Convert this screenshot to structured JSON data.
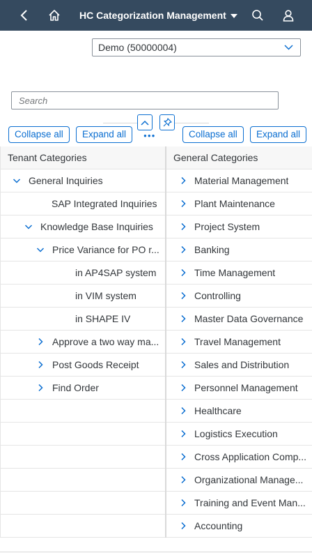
{
  "header": {
    "title": "HC Categorization Management",
    "back_icon": "back-icon",
    "home_icon": "home-icon",
    "search_icon": "search-icon",
    "user_icon": "user-icon"
  },
  "tenant_select": {
    "value": "Demo (50000004)"
  },
  "search": {
    "placeholder": "Search"
  },
  "toolbar": {
    "left_collapse": "Collapse all",
    "left_expand": "Expand all",
    "right_collapse": "Collapse all",
    "right_expand": "Expand all"
  },
  "left_tree": {
    "header": "Tenant Categories",
    "rows": [
      {
        "label": "General Inquiries",
        "level": 0,
        "state": "expanded"
      },
      {
        "label": "SAP Integrated Inquiries",
        "level": 1,
        "state": "leaf"
      },
      {
        "label": "Knowledge Base Inquiries",
        "level": 1,
        "state": "expanded"
      },
      {
        "label": "Price Variance for PO r...",
        "level": 2,
        "state": "expanded"
      },
      {
        "label": "in AP4SAP system",
        "level": 3,
        "state": "leaf"
      },
      {
        "label": "in VIM system",
        "level": 3,
        "state": "leaf"
      },
      {
        "label": "in SHAPE IV",
        "level": 3,
        "state": "leaf"
      },
      {
        "label": "Approve a two way ma...",
        "level": 2,
        "state": "collapsed"
      },
      {
        "label": "Post Goods Receipt",
        "level": 2,
        "state": "collapsed"
      },
      {
        "label": "Find Order",
        "level": 2,
        "state": "collapsed"
      },
      {
        "label": "",
        "level": 0,
        "state": "empty"
      },
      {
        "label": "",
        "level": 0,
        "state": "empty"
      },
      {
        "label": "",
        "level": 0,
        "state": "empty"
      },
      {
        "label": "",
        "level": 0,
        "state": "empty"
      },
      {
        "label": "",
        "level": 0,
        "state": "empty"
      },
      {
        "label": "",
        "level": 0,
        "state": "empty"
      }
    ]
  },
  "right_tree": {
    "header": "General Categories",
    "rows": [
      "Material Management",
      "Plant Maintenance",
      "Project System",
      "Banking",
      "Time Management",
      "Controlling",
      "Master Data Governance",
      "Travel Management",
      "Sales and Distribution",
      "Personnel Management",
      "Healthcare",
      "Logistics Execution",
      "Cross Application Comp...",
      "Organizational Manage...",
      "Training and Event Man...",
      "Accounting"
    ]
  },
  "colors": {
    "shell": "#354a5f",
    "accent": "#0a6ed1"
  }
}
